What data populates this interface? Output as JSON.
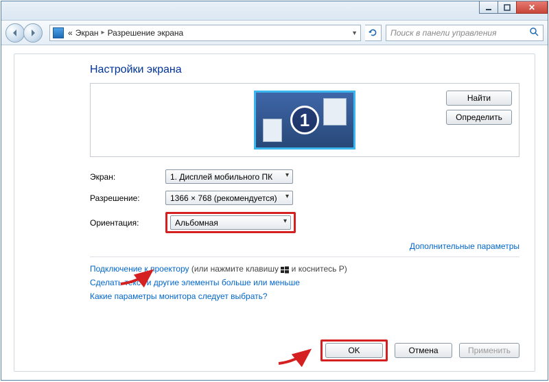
{
  "breadcrumb": {
    "prefix": "«",
    "item1": "Экран",
    "item2": "Разрешение экрана"
  },
  "search": {
    "placeholder": "Поиск в панели управления"
  },
  "heading": "Настройки экрана",
  "monitor_number": "1",
  "side_buttons": {
    "find": "Найти",
    "detect": "Определить"
  },
  "form": {
    "screen_label": "Экран:",
    "screen_value": "1. Дисплей мобильного ПК",
    "resolution_label": "Разрешение:",
    "resolution_value": "1366 × 768 (рекомендуется)",
    "orientation_label": "Ориентация:",
    "orientation_value": "Альбомная"
  },
  "advanced_link": "Дополнительные параметры",
  "links": {
    "projector_link": "Подключение к проектору",
    "projector_paren_a": " (или нажмите клавишу ",
    "projector_paren_b": " и коснитесь P)",
    "text_size": "Сделать текст и другие элементы больше или меньше",
    "which_settings": "Какие параметры монитора следует выбрать?"
  },
  "footer": {
    "ok": "OK",
    "cancel": "Отмена",
    "apply": "Применить"
  }
}
